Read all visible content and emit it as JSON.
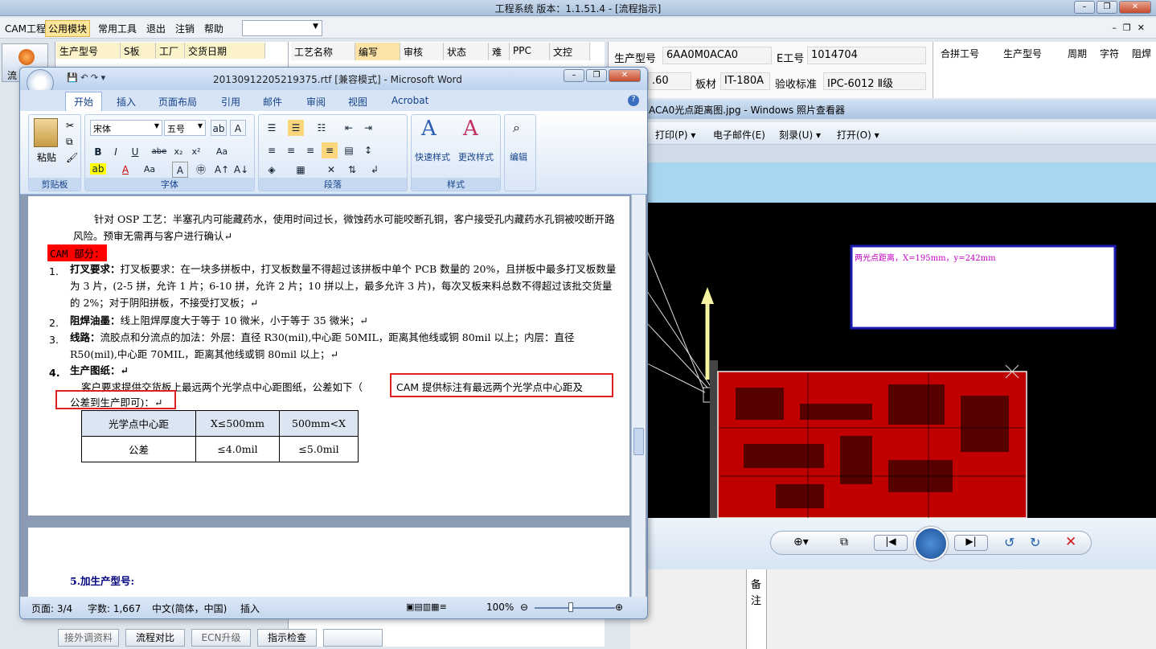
{
  "app": {
    "title": "工程系统   版本：1.1.51.4 - [流程指示]",
    "menu": [
      "CAM工程",
      "公用模块",
      "常用工具",
      "退出",
      "注销",
      "帮助"
    ],
    "selected_menu": "公用模块",
    "left_tab_label": "流",
    "grid_headers_left": [
      "生产型号",
      "S板",
      "工厂",
      "交货日期"
    ],
    "grid_headers_mid": [
      "工艺名称",
      "编写",
      "审核",
      "状态",
      "难",
      "PPC",
      "文控"
    ],
    "form": {
      "model_label": "生产型号",
      "model_value": "6AA0M0ACA0",
      "eno_label": "E工号",
      "eno_value": "1014704",
      "partial_value": ".60",
      "material_label": "板材",
      "material_value": "IT-180A",
      "standard_label": "验收标准",
      "standard_value": "IPC-6012 Ⅱ级"
    },
    "grid_headers_right": [
      "合拼工号",
      "生产型号",
      "周期",
      "字符",
      "阻焊"
    ],
    "side_labels": [
      "备",
      "注"
    ],
    "bottom_buttons": [
      "接外调资料",
      "流程对比",
      "ECN升级",
      "指示检查"
    ]
  },
  "photo_viewer": {
    "title": "ACA0光点距离图.jpg - Windows 照片查看器",
    "menu": [
      "打印(P)",
      "电子邮件(E)",
      "刻录(U)",
      "打开(O)"
    ],
    "annotation": "两光点距离，X=195mm，y=242mm"
  },
  "word": {
    "title": "20130912205219375.rtf [兼容模式] - Microsoft Word",
    "tabs": [
      "开始",
      "插入",
      "页面布局",
      "引用",
      "邮件",
      "审阅",
      "视图",
      "Acrobat"
    ],
    "active_tab": "开始",
    "font_name": "宋体",
    "font_size": "五号",
    "groups": [
      "剪贴板",
      "字体",
      "段落",
      "样式"
    ],
    "paste_label": "粘贴",
    "quick_style_label": "快速样式",
    "change_style_label": "更改样式",
    "edit_label": "编辑",
    "doc": {
      "p_osp": "针对 OSP 工艺：半塞孔内可能藏药水，使用时间过长，微蚀药水可能咬断孔铜，客户接受孔内藏药水孔铜被咬断开路风险。预审无需再与客户进行确认↵",
      "cam_heading": "CAM 部分：",
      "item1_title": "打叉要求：",
      "item1_text": "打叉板要求：在一块多拼板中，打叉板数量不得超过该拼板中单个 PCB 数量的 20%，且拼板中最多打叉板数量为 3 片，(2-5 拼，允许 1 片；6-10 拼，允许 2 片；10 拼以上，最多允许 3 片)，每次叉板来料总数不得超过该批交货量的 2%；对于阴阳拼板，不接受打叉板；↵",
      "item2_title": "阻焊油墨：",
      "item2_text": "线上阻焊厚度大于等于 10 微米，小于等于 35 微米；↵",
      "item3_title": "线路：",
      "item3_text": "流胶点和分流点的加法：外层：直径 R30(mil),中心距 50MIL，距离其他线或铜 80mil 以上；内层：直径 R50(mil),中心距 70MIL，距离其他线或铜 80mil 以上；↵",
      "item4_title": "生产图纸：↵",
      "item4_text_a": "客户要求提供交货板上最远两个光学点中心距图纸，公差如下（",
      "item4_text_b": "CAM 提供标注有最远两个光学点中心距及",
      "item4_text_c": "公差到生产即可)：↵",
      "table": {
        "headers": [
          "光学点中心距",
          "X≤500mm",
          "500mm<X"
        ],
        "row": [
          "公差",
          "≤4.0mil",
          "≤5.0mil"
        ]
      },
      "next_heading": "5.加生产型号:"
    },
    "status": {
      "page": "页面: 3/4",
      "words": "字数: 1,667",
      "lang": "中文(简体，中国)",
      "mode": "插入",
      "zoom": "100%"
    }
  }
}
